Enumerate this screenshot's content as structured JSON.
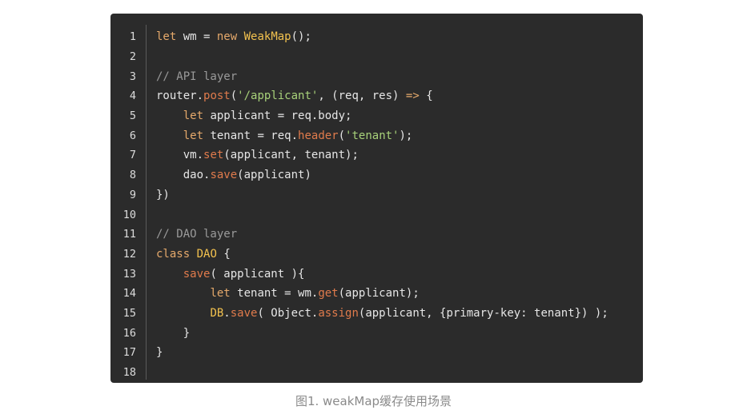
{
  "caption": "图1. weakMap缓存使用场景",
  "code": {
    "line_numbers": [
      "1",
      "2",
      "3",
      "4",
      "5",
      "6",
      "7",
      "8",
      "9",
      "10",
      "11",
      "12",
      "13",
      "14",
      "15",
      "16",
      "17",
      "18"
    ],
    "lines": [
      [
        {
          "t": "let",
          "c": "kw"
        },
        {
          "t": " wm = ",
          "c": "op"
        },
        {
          "t": "new",
          "c": "kw"
        },
        {
          "t": " ",
          "c": "op"
        },
        {
          "t": "WeakMap",
          "c": "cls"
        },
        {
          "t": "();",
          "c": "op"
        }
      ],
      [],
      [
        {
          "t": "// API layer",
          "c": "cmt"
        }
      ],
      [
        {
          "t": "router.",
          "c": "op"
        },
        {
          "t": "post",
          "c": "fn"
        },
        {
          "t": "(",
          "c": "op"
        },
        {
          "t": "'/applicant'",
          "c": "str"
        },
        {
          "t": ", (req, res) ",
          "c": "op"
        },
        {
          "t": "=>",
          "c": "kw"
        },
        {
          "t": " {",
          "c": "op"
        }
      ],
      [
        {
          "t": "    ",
          "c": "op"
        },
        {
          "t": "let",
          "c": "kw"
        },
        {
          "t": " applicant = req.body;",
          "c": "op"
        }
      ],
      [
        {
          "t": "    ",
          "c": "op"
        },
        {
          "t": "let",
          "c": "kw"
        },
        {
          "t": " tenant = req.",
          "c": "op"
        },
        {
          "t": "header",
          "c": "fn"
        },
        {
          "t": "(",
          "c": "op"
        },
        {
          "t": "'tenant'",
          "c": "str"
        },
        {
          "t": ");",
          "c": "op"
        }
      ],
      [
        {
          "t": "    vm.",
          "c": "op"
        },
        {
          "t": "set",
          "c": "fn"
        },
        {
          "t": "(applicant, tenant);",
          "c": "op"
        }
      ],
      [
        {
          "t": "    dao.",
          "c": "op"
        },
        {
          "t": "save",
          "c": "fn"
        },
        {
          "t": "(applicant)",
          "c": "op"
        }
      ],
      [
        {
          "t": "})",
          "c": "op"
        }
      ],
      [],
      [
        {
          "t": "// DAO layer",
          "c": "cmt"
        }
      ],
      [
        {
          "t": "class",
          "c": "kw"
        },
        {
          "t": " ",
          "c": "op"
        },
        {
          "t": "DAO",
          "c": "cls"
        },
        {
          "t": " {",
          "c": "op"
        }
      ],
      [
        {
          "t": "    ",
          "c": "op"
        },
        {
          "t": "save",
          "c": "fn"
        },
        {
          "t": "( applicant ){",
          "c": "op"
        }
      ],
      [
        {
          "t": "        ",
          "c": "op"
        },
        {
          "t": "let",
          "c": "kw"
        },
        {
          "t": " tenant = wm.",
          "c": "op"
        },
        {
          "t": "get",
          "c": "fn"
        },
        {
          "t": "(applicant);",
          "c": "op"
        }
      ],
      [
        {
          "t": "        ",
          "c": "op"
        },
        {
          "t": "DB",
          "c": "cls"
        },
        {
          "t": ".",
          "c": "op"
        },
        {
          "t": "save",
          "c": "fn"
        },
        {
          "t": "( Object.",
          "c": "op"
        },
        {
          "t": "assign",
          "c": "fn"
        },
        {
          "t": "(applicant, {primary-key: tenant}) );",
          "c": "op"
        }
      ],
      [
        {
          "t": "    }",
          "c": "op"
        }
      ],
      [
        {
          "t": "}",
          "c": "op"
        }
      ],
      []
    ]
  }
}
